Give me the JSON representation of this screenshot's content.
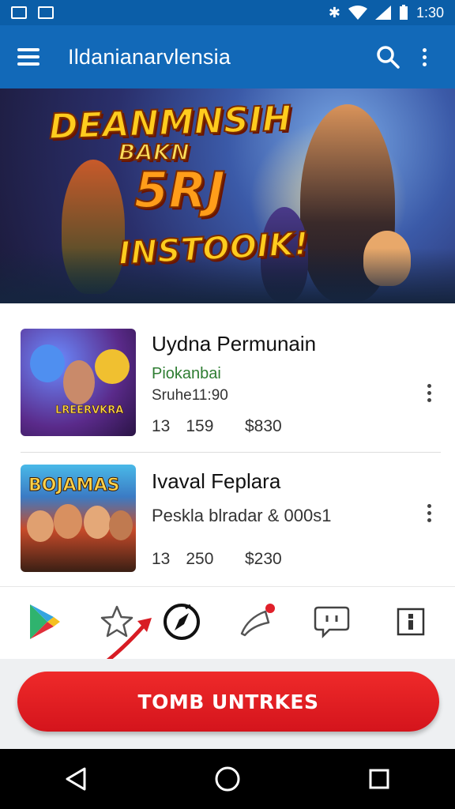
{
  "status_bar": {
    "time": "1:30"
  },
  "app_bar": {
    "title": "Ildanianarvlensia"
  },
  "banner": {
    "line1": "DEANMNSIH",
    "line2": "BAKN",
    "line3": "5RJ",
    "line4": "INSTOOIK!"
  },
  "games": [
    {
      "title": "Uydna Permunain",
      "subtitle": "Piokanbai",
      "detail": "Sruhe11:90",
      "meta_a": "13",
      "meta_b": "159",
      "price": "$830",
      "thumb_tag": "LREERVKRA"
    },
    {
      "title": "Ivaval Feplara",
      "subtitle": "",
      "detail": "Peskla blradar & 000s1",
      "meta_a": "13",
      "meta_b": "250",
      "price": "$230",
      "thumb_tag": "BOJAMAS"
    }
  ],
  "tabs": [
    {
      "icon": "play-store-icon"
    },
    {
      "icon": "star-icon"
    },
    {
      "icon": "compass-icon"
    },
    {
      "icon": "megaphone-icon",
      "badge": "0"
    },
    {
      "icon": "chat-icon"
    },
    {
      "icon": "info-icon"
    }
  ],
  "cta": {
    "label": "TOMB UNTRKES"
  },
  "colors": {
    "app_bar": "#1269b8",
    "status_bar": "#0b5ea8",
    "cta": "#e01a22",
    "subtitle_green": "#2e7d32"
  }
}
